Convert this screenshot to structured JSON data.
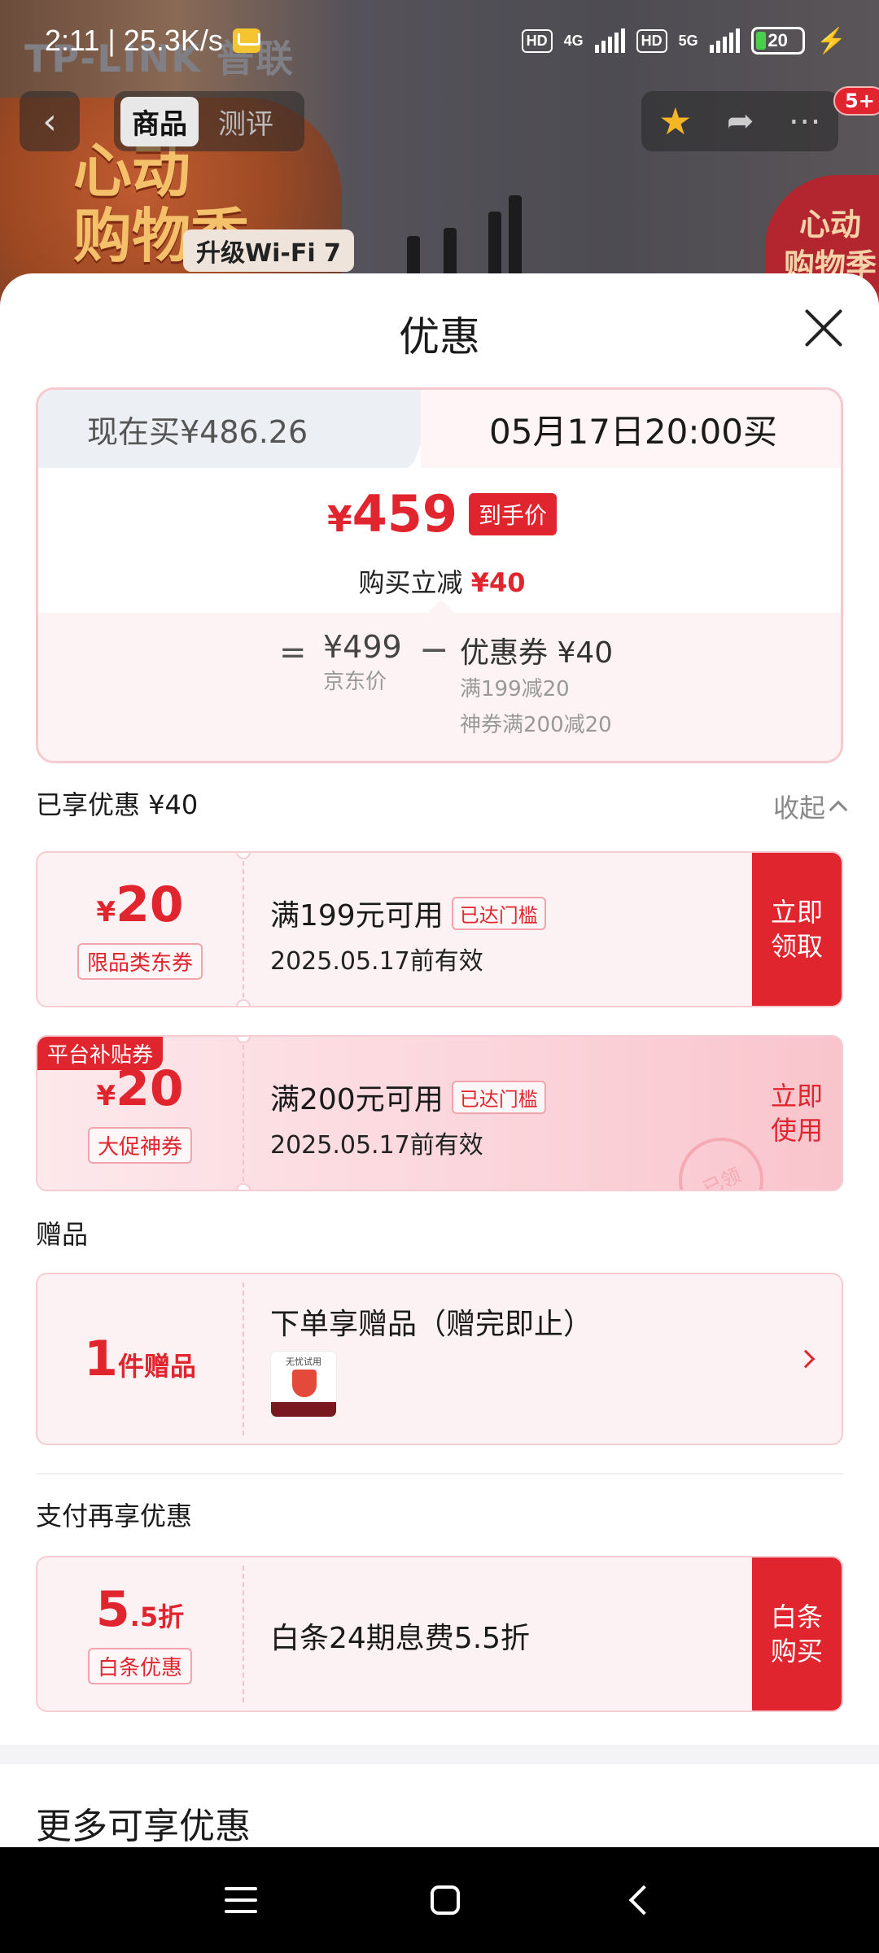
{
  "status_bar": {
    "time_speed": "2:11 | 25.3K/s",
    "hd1": "HD",
    "net1": "4G",
    "hd2": "HD",
    "net2": "5G",
    "battery": "20"
  },
  "backdrop": {
    "brand": "TP-LINK 普联",
    "promo_line1": "心动",
    "promo_line2": "购物季",
    "promo_tag": "升级Wi-Fi 7",
    "right_badge_line1": "心动",
    "right_badge_line2": "购物季"
  },
  "nav": {
    "tabs": [
      {
        "label": "商品",
        "active": true
      },
      {
        "label": "测评",
        "active": false
      }
    ],
    "cart_badge": "5+"
  },
  "sheet": {
    "title": "优惠",
    "price_card": {
      "now_buy": "现在买¥486.26",
      "scheduled_buy": "05月17日20:00买",
      "final_price_symbol": "¥",
      "final_price": "459",
      "final_tag": "到手价",
      "reduce_label": "购买立减",
      "reduce_value": "¥40",
      "eq": "=",
      "jd_price": "¥499",
      "jd_label": "京东价",
      "minus": "−",
      "coupon_line": "优惠券 ¥40",
      "coupon_detail1": "满199减20",
      "coupon_detail2": "神券满200减20"
    },
    "enjoyed_label": "已享优惠 ¥40",
    "collapse_label": "收起",
    "coupons": [
      {
        "symbol": "¥",
        "amount": "20",
        "type": "限品类东券",
        "condition": "满199元可用",
        "reached": "已达门槛",
        "validity": "2025.05.17前有效",
        "action": "立即领取"
      },
      {
        "corner": "平台补贴券",
        "symbol": "¥",
        "amount": "20",
        "type": "大促神券",
        "condition": "满200元可用",
        "reached": "已达门槛",
        "validity": "2025.05.17前有效",
        "action": "立即使用",
        "stamp": "已领"
      }
    ],
    "gift_section_label": "赠品",
    "gift": {
      "count": "1",
      "count_unit": "件赠品",
      "title": "下单享赠品（赠完即止）",
      "thumb_text": "无忧试用"
    },
    "pay_section_label": "支付再享优惠",
    "pay": {
      "amount": "5",
      "unit": ".5折",
      "type": "白条优惠",
      "desc": "白条24期息费5.5折",
      "action": "白条购买"
    },
    "more_title": "更多可享优惠"
  },
  "colors": {
    "accent_red": "#e1252f",
    "card_bg": "#fdf2f3",
    "tab_gray": "#eceff4"
  },
  "icons": [
    "mail-icon",
    "signal-icon",
    "battery-icon",
    "back-arrow-icon",
    "star-icon",
    "share-icon",
    "more-icon",
    "close-icon",
    "chevron-up-icon",
    "chevron-right-icon",
    "menu-icon",
    "home-icon",
    "back-icon"
  ]
}
